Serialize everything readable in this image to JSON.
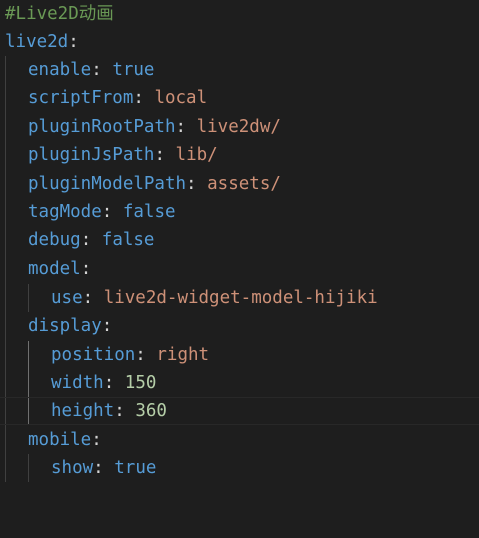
{
  "editor": {
    "language": "yaml",
    "colors": {
      "background": "#1e1e1e",
      "comment": "#6a9955",
      "key": "#569cd6",
      "string": "#ce9178",
      "number": "#b5cea8",
      "boolean": "#569cd6",
      "punctuation": "#d4d4d4"
    },
    "lines": {
      "comment": "#Live2D动画",
      "root_key": "live2d",
      "enable": {
        "key": "enable",
        "value": "true"
      },
      "scriptFrom": {
        "key": "scriptFrom",
        "value": "local"
      },
      "pluginRootPath": {
        "key": "pluginRootPath",
        "value": "live2dw/"
      },
      "pluginJsPath": {
        "key": "pluginJsPath",
        "value": "lib/"
      },
      "pluginModelPath": {
        "key": "pluginModelPath",
        "value": "assets/"
      },
      "tagMode": {
        "key": "tagMode",
        "value": "false"
      },
      "debug": {
        "key": "debug",
        "value": "false"
      },
      "model": {
        "key": "model"
      },
      "model_use": {
        "key": "use",
        "value": "live2d-widget-model-hijiki"
      },
      "display": {
        "key": "display"
      },
      "display_position": {
        "key": "position",
        "value": "right"
      },
      "display_width": {
        "key": "width",
        "value": "150"
      },
      "display_height": {
        "key": "height",
        "value": "360"
      },
      "mobile": {
        "key": "mobile"
      },
      "mobile_show": {
        "key": "show",
        "value": "true"
      }
    },
    "colon": ":"
  }
}
